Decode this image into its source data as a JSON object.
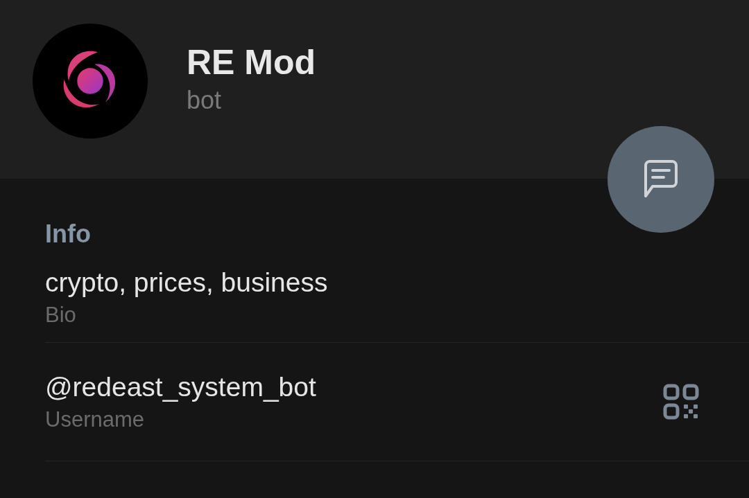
{
  "profile": {
    "name": "RE Mod",
    "subtitle": "bot"
  },
  "info": {
    "title": "Info",
    "rows": [
      {
        "kind": "text",
        "value": "crypto, prices, business",
        "label": "Bio"
      },
      {
        "kind": "qr",
        "value": "@redeast_system_bot",
        "label": "Username"
      }
    ]
  }
}
